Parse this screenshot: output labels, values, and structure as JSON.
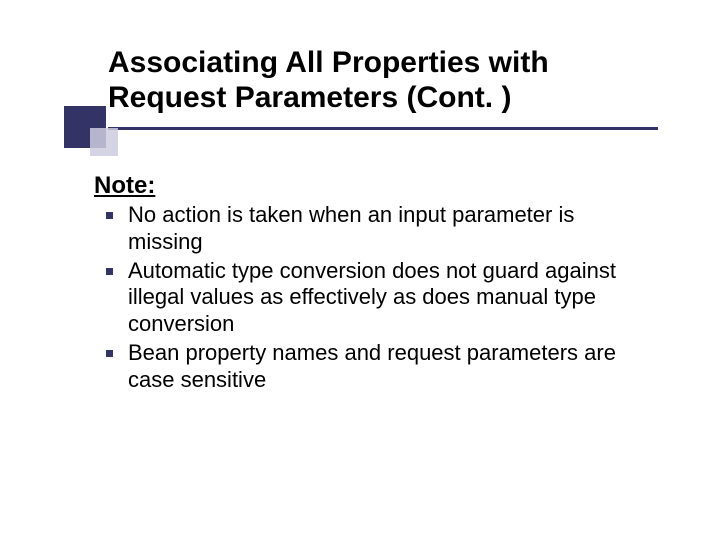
{
  "title": "Associating All Properties with Request Parameters (Cont. )",
  "noteLabel": "Note:",
  "bullets": [
    "No action is taken when an input parameter is missing",
    "Automatic type conversion does not guard against illegal values as effectively as does manual type conversion",
    "Bean property names and request parameters are case sensitive"
  ]
}
